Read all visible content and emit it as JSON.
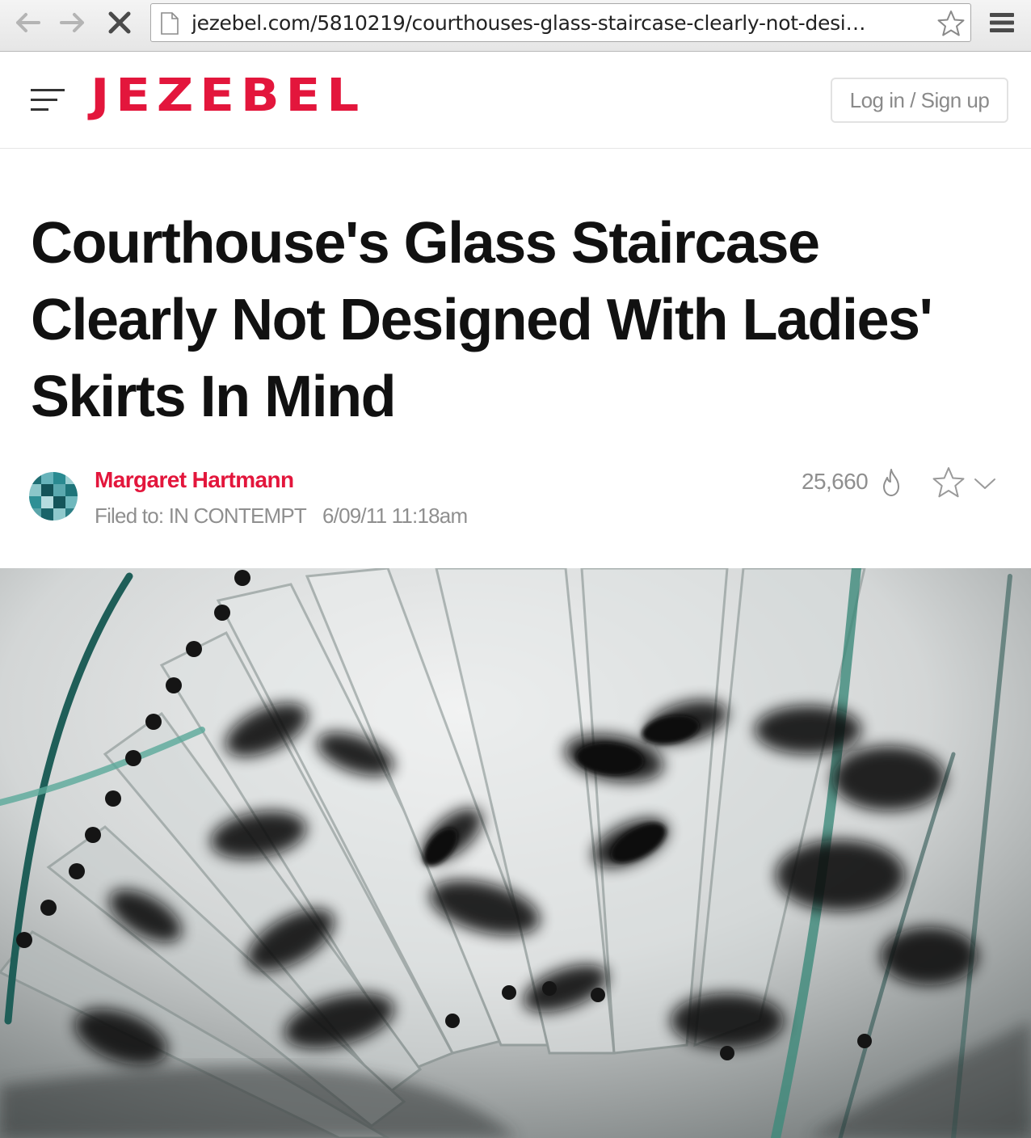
{
  "browser": {
    "url": "jezebel.com/5810219/courthouses-glass-staircase-clearly-not-desi…",
    "icons": [
      "back-arrow-icon",
      "forward-arrow-icon",
      "stop-loading-icon",
      "page-icon",
      "bookmark-star-icon",
      "browser-menu-icon"
    ]
  },
  "header": {
    "logo": "JEZEBEL",
    "login_label": "Log in / Sign up",
    "accent_color": "#e3163c"
  },
  "article": {
    "title": "Courthouse's Glass Staircase Clearly Not Designed With Ladies' Skirts In Mind",
    "author": "Margaret Hartmann",
    "filed_to": "Filed to: IN CONTEMPT",
    "date": "6/09/11 11:18am",
    "view_count": "25,660"
  }
}
